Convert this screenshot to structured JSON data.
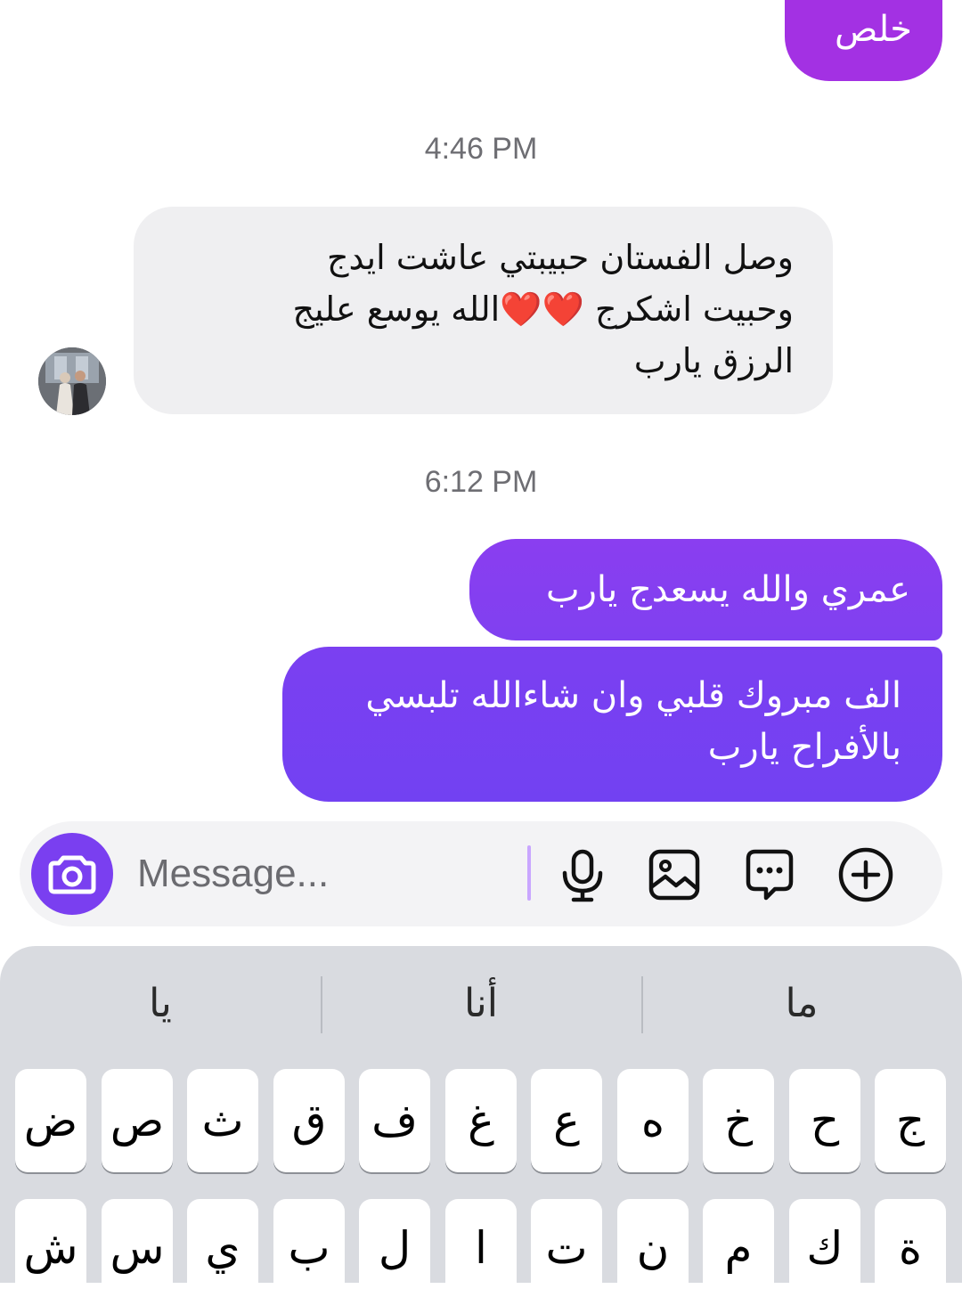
{
  "messages": {
    "top_sent": "خلص",
    "timestamp_1": "4:46 PM",
    "received": {
      "line1": "وصل الفستان حبيبتي عاشت ايدج",
      "line2": "وحبيت اشكرج ❤️❤️الله يوسع عليج",
      "line3": "الرزق يارب"
    },
    "timestamp_2": "6:12 PM",
    "sent_1": "عمري والله يسعدج يارب",
    "sent_2": {
      "line1": "الف مبروك قلبي وان شاءالله تلبسي",
      "line2": "بالأفراح يارب"
    }
  },
  "composer": {
    "placeholder": "Message...",
    "icons": [
      "camera-icon",
      "microphone-icon",
      "gallery-icon",
      "sticker-icon",
      "add-icon"
    ]
  },
  "keyboard": {
    "suggestions": [
      "يا",
      "أنا",
      "ما"
    ],
    "row1": [
      "ض",
      "ص",
      "ث",
      "ق",
      "ف",
      "غ",
      "ع",
      "ه",
      "خ",
      "ح",
      "ج"
    ],
    "row2": [
      "ش",
      "س",
      "ي",
      "ب",
      "ل",
      "ا",
      "ت",
      "ن",
      "م",
      "ك",
      "ة"
    ]
  },
  "colors": {
    "sent_gradient_top": "#a331e3",
    "sent_gradient_mid": "#8240f0",
    "sent_gradient_bottom": "#7241f2",
    "received_bubble": "#efeff1",
    "camera_button": "#7a3ff0"
  }
}
